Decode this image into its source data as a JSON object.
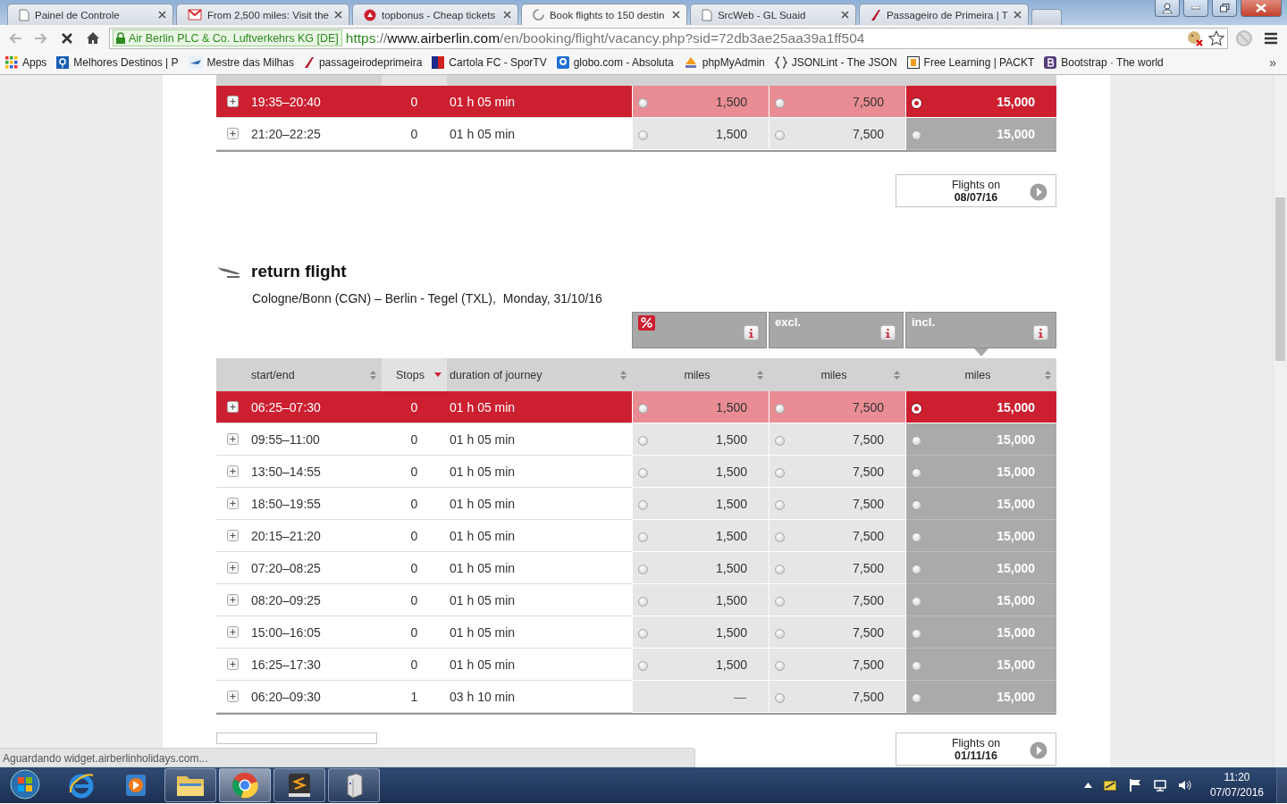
{
  "browser": {
    "tabs": [
      {
        "title": "Painel de Controle",
        "kind": "page",
        "selected": false
      },
      {
        "title": "From 2,500 miles: Visit the",
        "kind": "mail",
        "selected": false
      },
      {
        "title": "topbonus - Cheap tickets",
        "kind": "brand",
        "selected": false
      },
      {
        "title": "Book flights to 150 destin",
        "kind": "loading",
        "selected": true
      },
      {
        "title": "SrcWeb - GL Suaid",
        "kind": "page",
        "selected": false
      },
      {
        "title": "Passageiro de Primeira | T",
        "kind": "airline",
        "selected": false
      }
    ],
    "address_bar": {
      "identity": "Air Berlin PLC & Co. Luftverkehrs KG [DE]",
      "scheme": "https",
      "separator": "://",
      "host": "www.airberlin.com",
      "path": "/en/booking/flight/vacancy.php?sid=72db3ae25aa39a1ff504"
    },
    "bookmarks": [
      {
        "label": "Apps",
        "kind": "apps"
      },
      {
        "label": "Melhores Destinos | P",
        "kind": "pin"
      },
      {
        "label": "Mestre das Milhas",
        "kind": "plane"
      },
      {
        "label": "passageirodeprimeira",
        "kind": "airline"
      },
      {
        "label": "Cartola FC - SporTV",
        "kind": "flag"
      },
      {
        "label": "globo.com - Absoluta",
        "kind": "globo"
      },
      {
        "label": "phpMyAdmin",
        "kind": "pma"
      },
      {
        "label": "JSONLint - The JSON",
        "kind": "braces"
      },
      {
        "label": "Free Learning | PACKT",
        "kind": "packt"
      },
      {
        "label": "Bootstrap · The world",
        "kind": "bootstrap"
      }
    ],
    "overflow": "»"
  },
  "outbound": {
    "columns": [
      {
        "sorted": false
      },
      {
        "sorted": true
      },
      {
        "sorted": false
      },
      {
        "sorted": false
      },
      {
        "sorted": false
      },
      {
        "sorted": false
      }
    ],
    "rows": [
      {
        "time": "19:35–20:40",
        "stops": "0",
        "duration": "01 h 05 min",
        "selected": true,
        "fares": [
          {
            "value": "1,500",
            "kind": "option",
            "selected": false
          },
          {
            "value": "7,500",
            "kind": "option",
            "selected": false
          },
          {
            "value": "15,000",
            "kind": "option",
            "selected": true
          }
        ]
      },
      {
        "time": "21:20–22:25",
        "stops": "0",
        "duration": "01 h 05 min",
        "selected": false,
        "fares": [
          {
            "value": "1,500",
            "kind": "option",
            "selected": false
          },
          {
            "value": "7,500",
            "kind": "option",
            "selected": false
          },
          {
            "value": "15,000",
            "kind": "option",
            "selected": false
          }
        ]
      }
    ],
    "next_day": {
      "label": "Flights on",
      "date": "08/07/16"
    }
  },
  "return_flight": {
    "title": "return flight",
    "route": "Cologne/Bonn (CGN) – Berlin - Tegel (TXL),",
    "day": "Monday, 31/10/16",
    "fare_headers": [
      {
        "kind": "discount",
        "selected": false
      },
      {
        "kind": "label",
        "label": "excl.",
        "selected": false
      },
      {
        "kind": "label",
        "label": "incl.",
        "selected": true
      }
    ],
    "columns": [
      {
        "label": "start/end",
        "sorted": false
      },
      {
        "label": "Stops",
        "sorted": true
      },
      {
        "label": "duration of journey",
        "sorted": false
      },
      {
        "label": "miles",
        "sorted": false
      },
      {
        "label": "miles",
        "sorted": false
      },
      {
        "label": "miles",
        "sorted": false
      }
    ],
    "rows": [
      {
        "time": "06:25–07:30",
        "stops": "0",
        "duration": "01 h 05 min",
        "selected": true,
        "fares": [
          {
            "value": "1,500",
            "kind": "option",
            "selected": false
          },
          {
            "value": "7,500",
            "kind": "option",
            "selected": false
          },
          {
            "value": "15,000",
            "kind": "option",
            "selected": true
          }
        ]
      },
      {
        "time": "09:55–11:00",
        "stops": "0",
        "duration": "01 h 05 min",
        "selected": false,
        "fares": [
          {
            "value": "1,500",
            "kind": "option",
            "selected": false
          },
          {
            "value": "7,500",
            "kind": "option",
            "selected": false
          },
          {
            "value": "15,000",
            "kind": "option",
            "selected": false
          }
        ]
      },
      {
        "time": "13:50–14:55",
        "stops": "0",
        "duration": "01 h 05 min",
        "selected": false,
        "fares": [
          {
            "value": "1,500",
            "kind": "option",
            "selected": false
          },
          {
            "value": "7,500",
            "kind": "option",
            "selected": false
          },
          {
            "value": "15,000",
            "kind": "option",
            "selected": false
          }
        ]
      },
      {
        "time": "18:50–19:55",
        "stops": "0",
        "duration": "01 h 05 min",
        "selected": false,
        "fares": [
          {
            "value": "1,500",
            "kind": "option",
            "selected": false
          },
          {
            "value": "7,500",
            "kind": "option",
            "selected": false
          },
          {
            "value": "15,000",
            "kind": "option",
            "selected": false
          }
        ]
      },
      {
        "time": "20:15–21:20",
        "stops": "0",
        "duration": "01 h 05 min",
        "selected": false,
        "fares": [
          {
            "value": "1,500",
            "kind": "option",
            "selected": false
          },
          {
            "value": "7,500",
            "kind": "option",
            "selected": false
          },
          {
            "value": "15,000",
            "kind": "option",
            "selected": false
          }
        ]
      },
      {
        "time": "07:20–08:25",
        "stops": "0",
        "duration": "01 h 05 min",
        "selected": false,
        "fares": [
          {
            "value": "1,500",
            "kind": "option",
            "selected": false
          },
          {
            "value": "7,500",
            "kind": "option",
            "selected": false
          },
          {
            "value": "15,000",
            "kind": "option",
            "selected": false
          }
        ]
      },
      {
        "time": "08:20–09:25",
        "stops": "0",
        "duration": "01 h 05 min",
        "selected": false,
        "fares": [
          {
            "value": "1,500",
            "kind": "option",
            "selected": false
          },
          {
            "value": "7,500",
            "kind": "option",
            "selected": false
          },
          {
            "value": "15,000",
            "kind": "option",
            "selected": false
          }
        ]
      },
      {
        "time": "15:00–16:05",
        "stops": "0",
        "duration": "01 h 05 min",
        "selected": false,
        "fares": [
          {
            "value": "1,500",
            "kind": "option",
            "selected": false
          },
          {
            "value": "7,500",
            "kind": "option",
            "selected": false
          },
          {
            "value": "15,000",
            "kind": "option",
            "selected": false
          }
        ]
      },
      {
        "time": "16:25–17:30",
        "stops": "0",
        "duration": "01 h 05 min",
        "selected": false,
        "fares": [
          {
            "value": "1,500",
            "kind": "option",
            "selected": false
          },
          {
            "value": "7,500",
            "kind": "option",
            "selected": false
          },
          {
            "value": "15,000",
            "kind": "option",
            "selected": false
          }
        ]
      },
      {
        "time": "06:20–09:30",
        "stops": "1",
        "duration": "03 h 10 min",
        "selected": false,
        "fares": [
          {
            "value": "—",
            "kind": "unavailable"
          },
          {
            "value": "7,500",
            "kind": "option",
            "selected": false
          },
          {
            "value": "15,000",
            "kind": "option",
            "selected": false
          }
        ]
      }
    ],
    "next_day": {
      "label": "Flights on",
      "date": "01/11/16"
    }
  },
  "status_text": "Aguardando widget.airberlinholidays.com...",
  "taskbar": {
    "apps": [
      {
        "kind": "ie",
        "running": false,
        "selected": false
      },
      {
        "kind": "media",
        "running": false,
        "selected": false
      },
      {
        "kind": "explorer",
        "running": true,
        "selected": false
      },
      {
        "kind": "chrome",
        "running": true,
        "selected": true
      },
      {
        "kind": "sublime",
        "running": true,
        "selected": false
      },
      {
        "kind": "server",
        "running": true,
        "selected": false
      }
    ],
    "time": "11:20",
    "date": "07/07/2016"
  }
}
